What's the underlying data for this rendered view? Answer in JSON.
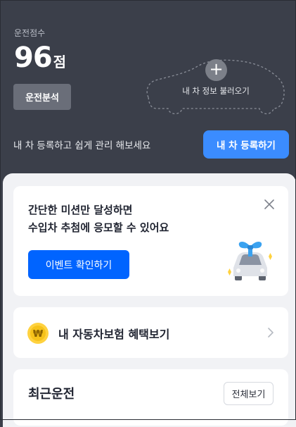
{
  "header": {
    "score_label": "운전점수",
    "score_value": "96",
    "score_unit": "점",
    "analysis_button": "운전분석",
    "add_car_text": "내 차 정보 불러오기",
    "register_prompt": "내 차 등록하고 쉽게 관리 해보세요",
    "register_button": "내 차 등록하기"
  },
  "event_card": {
    "line1": "간단한 미션만 달성하면",
    "line2": "수입차 추첨에 응모할 수 있어요",
    "button": "이벤트 확인하기"
  },
  "insurance_card": {
    "label": "내 자동차보험 혜택보기",
    "icon_glyph": "₩"
  },
  "recent_card": {
    "title": "최근운전",
    "view_all": "전체보기"
  },
  "colors": {
    "header_bg": "#3b3f4a",
    "primary": "#0064ff",
    "register_blue": "#3b8cff",
    "sheet_bg": "#f1f2f5"
  }
}
